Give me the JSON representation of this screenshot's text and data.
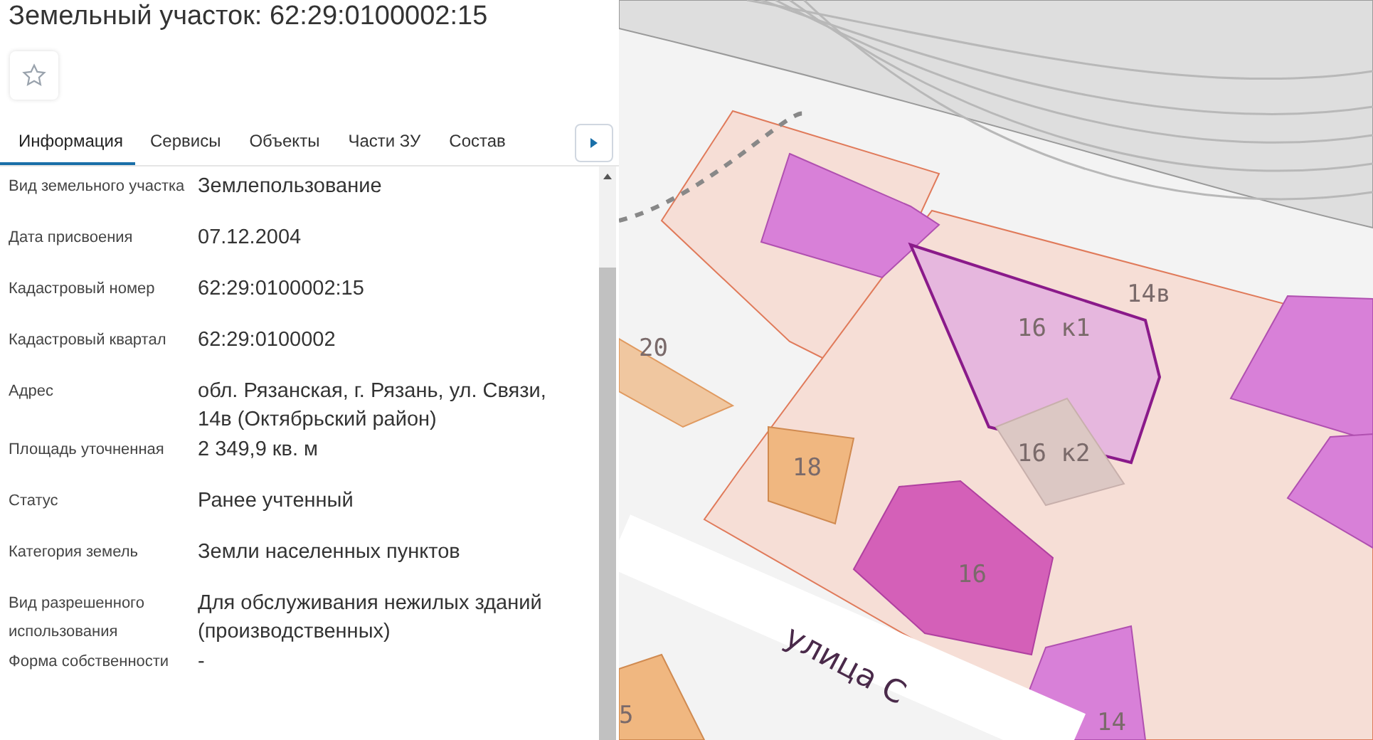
{
  "title": "Земельный участок: 62:29:0100002:15",
  "favorite": {
    "on": false
  },
  "tabs": [
    {
      "label": "Информация",
      "selected": true
    },
    {
      "label": "Сервисы",
      "selected": false
    },
    {
      "label": "Объекты",
      "selected": false
    },
    {
      "label": "Части ЗУ",
      "selected": false
    },
    {
      "label": "Состав",
      "selected": false
    }
  ],
  "fields": [
    {
      "label": "Вид земельного участка",
      "value": "Землепользование"
    },
    {
      "label": "Дата присвоения",
      "value": "07.12.2004"
    },
    {
      "label": "Кадастровый номер",
      "value": "62:29:0100002:15"
    },
    {
      "label": "Кадастровый квартал",
      "value": "62:29:0100002"
    },
    {
      "label": "Адрес",
      "value": "обл. Рязанская, г. Рязань, ул. Связи, 14в (Октябрьский район)"
    },
    {
      "label": "Площадь уточненная",
      "value": "2 349,9 кв. м"
    },
    {
      "label": "Статус",
      "value": "Ранее учтенный"
    },
    {
      "label": "Категория земель",
      "value": "Земли населенных пунктов"
    },
    {
      "label": "Вид разрешенного использования",
      "value": "Для обслуживания нежилых зданий (производственных)"
    },
    {
      "label": "Форма собственности",
      "value": "-"
    }
  ],
  "map": {
    "labels": [
      {
        "text": "14в"
      },
      {
        "text": "16 к1"
      },
      {
        "text": "20"
      },
      {
        "text": "16 к2"
      },
      {
        "text": "18"
      },
      {
        "text": "16"
      },
      {
        "text": "5"
      },
      {
        "text": "14"
      }
    ],
    "street": "улица С"
  }
}
